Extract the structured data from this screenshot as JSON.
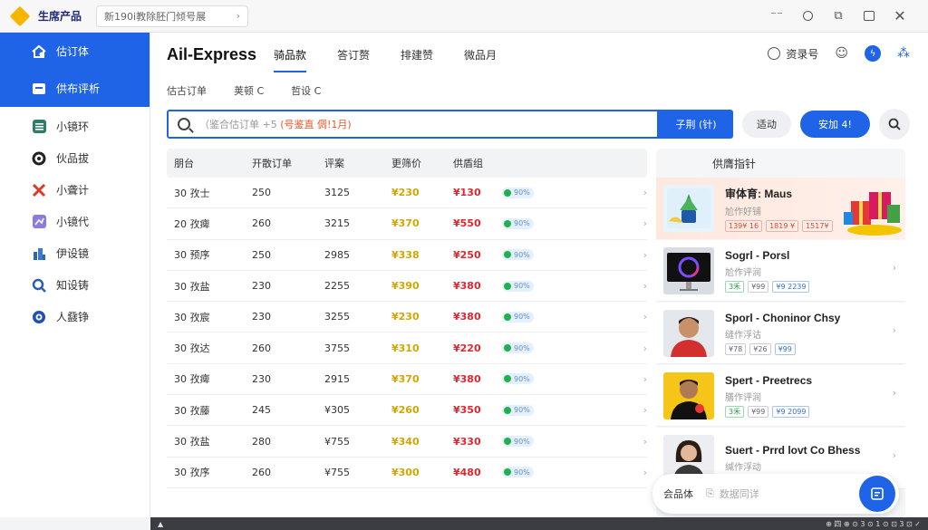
{
  "titlebar": {
    "app_name": "生席产品",
    "tab_text": "新190i教除胚门倾号展",
    "controls": [
      "minimize-icon",
      "circle-icon",
      "puzzle-icon",
      "chat-icon",
      "close-icon"
    ]
  },
  "sidebar": {
    "top_items": [
      {
        "label": "估订体",
        "icon": "home-gear-icon"
      },
      {
        "label": "供布评析",
        "icon": "report-icon"
      }
    ],
    "items": [
      {
        "label": "小镜环",
        "icon": "list-icon"
      },
      {
        "label": "伙品拔",
        "icon": "gear-icon"
      },
      {
        "label": "小聋计",
        "icon": "tools-icon"
      },
      {
        "label": "小镜代",
        "icon": "chart-icon"
      },
      {
        "label": "伊设镜",
        "icon": "building-icon"
      },
      {
        "label": "知设铸",
        "icon": "search-cog-icon"
      },
      {
        "label": "人鼗铮",
        "icon": "target-icon"
      }
    ]
  },
  "header": {
    "brand": "Ail-Express",
    "tabs": [
      {
        "label": "骑品款",
        "active": true
      },
      {
        "label": "答订赘",
        "active": false
      },
      {
        "label": "排建赞",
        "active": false
      },
      {
        "label": "微品月",
        "active": false
      }
    ],
    "account_label": "资录号"
  },
  "subtabs": [
    "估古订单",
    "荚顿 C",
    "哲设 C"
  ],
  "search": {
    "placeholder_pre": "（鉴合估订单 +5 ",
    "placeholder_hl": "(号鉴直 倜!1月)",
    "button_label": "子荆 (针)",
    "secondary_label": "适动",
    "primary_label": "安加 4!"
  },
  "table": {
    "headers": [
      "朋台",
      "开散订单",
      "评案",
      "更筛价",
      "供盾组"
    ],
    "rows": [
      {
        "c1": "30  孜士",
        "c2": "250",
        "c3": "3125",
        "price": "¥230",
        "price_color": "yellow",
        "cost": "¥130",
        "badge": "90%"
      },
      {
        "c1": "20  孜痺",
        "c2": "260",
        "c3": "3215",
        "price": "¥370",
        "price_color": "yellow",
        "cost": "¥550",
        "badge": "90%"
      },
      {
        "c1": "30  预序",
        "c2": "250",
        "c3": "2985",
        "price": "¥338",
        "price_color": "yellow",
        "cost": "¥250",
        "badge": "90%"
      },
      {
        "c1": "30  孜盐",
        "c2": "230",
        "c3": "2255",
        "price": "¥390",
        "price_color": "yellow",
        "cost": "¥380",
        "badge": "90%"
      },
      {
        "c1": "30  孜宸",
        "c2": "230",
        "c3": "3255",
        "price": "¥230",
        "price_color": "yellow",
        "cost": "¥380",
        "badge": "90%"
      },
      {
        "c1": "30  孜达",
        "c2": "260",
        "c3": "3755",
        "price": "¥310",
        "price_color": "yellow",
        "cost": "¥220",
        "badge": "90%"
      },
      {
        "c1": "30  孜痺",
        "c2": "230",
        "c3": "2915",
        "price": "¥370",
        "price_color": "yellow",
        "cost": "¥380",
        "badge": "90%"
      },
      {
        "c1": "30  孜藤",
        "c2": "245",
        "c3": "¥305",
        "price": "¥260",
        "price_color": "yellow",
        "cost": "¥350",
        "badge": "90%"
      },
      {
        "c1": "30  孜盐",
        "c2": "280",
        "c3": "¥755",
        "price": "¥340",
        "price_color": "yellow",
        "cost": "¥330",
        "badge": "90%"
      },
      {
        "c1": "30  孜序",
        "c2": "260",
        "c3": "¥755",
        "price": "¥300",
        "price_color": "yellow",
        "cost": "¥480",
        "badge": "90%"
      }
    ]
  },
  "panel": {
    "title": "供膺指针",
    "featured": {
      "name": "审体育: Maus",
      "sub": "尬作好铺",
      "tags": [
        "139¥ 16",
        "1819 ¥",
        "1517¥"
      ]
    },
    "products": [
      {
        "name": "Sogrl - Porsl",
        "sub": "尬作评润",
        "tags": [
          "3禾",
          "¥99",
          "¥9 2239"
        ],
        "thumb": "monitor"
      },
      {
        "name": "Sporl - Choninor Chsy",
        "sub": "缝作浮诂",
        "tags": [
          "¥78",
          "¥26",
          "¥99"
        ],
        "thumb": "person-red"
      },
      {
        "name": "Spert - Preetrecs",
        "sub": "膳作评润",
        "tags": [
          "3禾",
          "¥99",
          "¥9 2099"
        ],
        "thumb": "person-yellow"
      },
      {
        "name": "Suert - Prrd lovt Co Bhess",
        "sub": "缄作浮动",
        "tags": [],
        "thumb": "person-gray"
      }
    ]
  },
  "floatbar": {
    "label": "会品体",
    "placeholder": "数据同详"
  },
  "statusbar": {
    "right_text": "⊕ 四 ⊕ ⊙ 3 ⊙ 1 ⊙ ⊡ 3 ⊡ ✓"
  },
  "colors": {
    "accent": "#1f63e6",
    "price_yellow": "#d4a500",
    "cost_red": "#e0262e",
    "badge_green": "#22b04c"
  }
}
